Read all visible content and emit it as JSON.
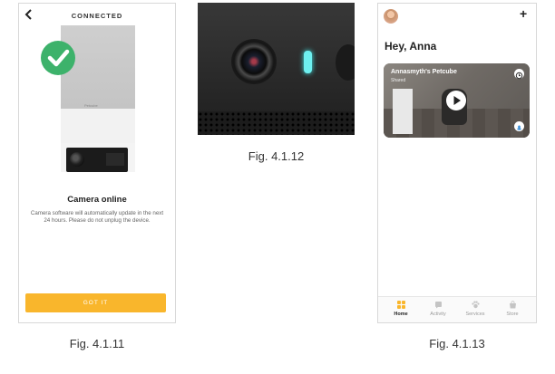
{
  "fig1": {
    "header_title": "CONNECTED",
    "device_brand": "Petcube",
    "heading": "Camera online",
    "body": "Camera software will automatically update in the next 24 hours. Please do not unplug the device.",
    "button_label": "GOT IT",
    "caption": "Fig. 4.1.11",
    "accent": "#f9b62c",
    "check_color": "#3db26b"
  },
  "fig2": {
    "caption": "Fig. 4.1.12",
    "led_color": "#6ef0f0"
  },
  "fig3": {
    "greeting": "Hey, Anna",
    "card_title": "Annasmyth's Petcube",
    "card_subtitle": "Shared",
    "caption": "Fig. 4.1.13",
    "tabs": [
      {
        "label": "Home",
        "icon": "home-icon",
        "active": true
      },
      {
        "label": "Activity",
        "icon": "activity-icon",
        "active": false
      },
      {
        "label": "Services",
        "icon": "services-icon",
        "active": false
      },
      {
        "label": "Store",
        "icon": "store-icon",
        "active": false
      }
    ],
    "tab_active_color": "#f9b62c"
  }
}
